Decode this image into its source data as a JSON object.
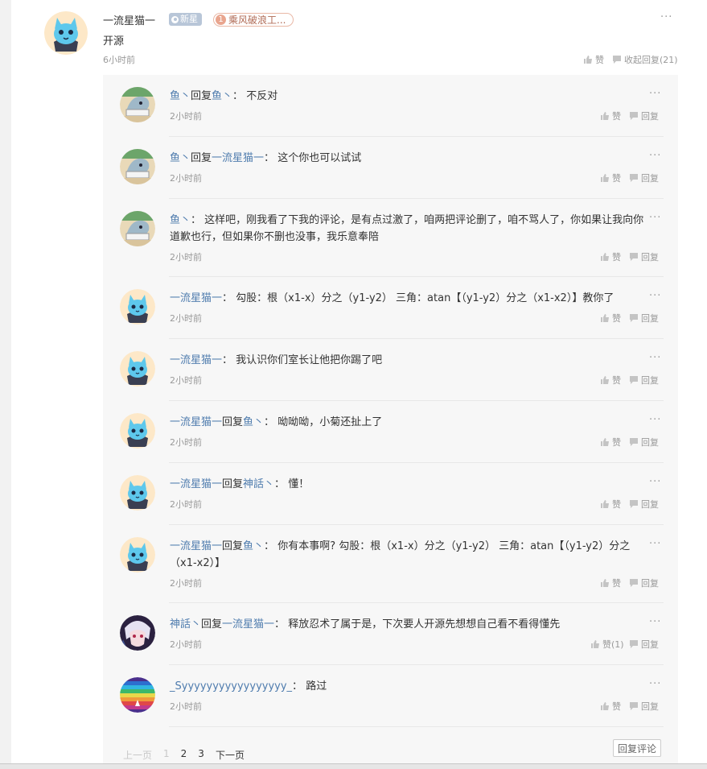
{
  "main_comment": {
    "username": "一流星猫一",
    "badge_new": "新星",
    "badge_level_num": "1",
    "badge_level_text": "乘风破浪工...",
    "content": "开源",
    "time": "6小时前",
    "like_label": "赞",
    "collapse_label": "收起回复(21)",
    "more": "···"
  },
  "replies": [
    {
      "avatar": "fish",
      "user": "鱼丶",
      "reply_word": "回复",
      "target": "鱼丶",
      "sep": "：",
      "text": "不反对",
      "time": "2小时前",
      "like": "赞",
      "reply": "回复"
    },
    {
      "avatar": "fish",
      "user": "鱼丶",
      "reply_word": "回复",
      "target": "一流星猫一",
      "sep": "：",
      "text": "这个你也可以试试",
      "time": "2小时前",
      "like": "赞",
      "reply": "回复"
    },
    {
      "avatar": "fish",
      "user": "鱼丶",
      "reply_word": "",
      "target": "",
      "sep": "：",
      "text": "这样吧，刚我看了下我的评论，是有点过激了，咱两把评论删了，咱不骂人了，你如果让我向你道歉也行，但如果你不删也没事，我乐意奉陪",
      "time": "2小时前",
      "like": "赞",
      "reply": "回复"
    },
    {
      "avatar": "cat",
      "user": "一流星猫一",
      "reply_word": "",
      "target": "",
      "sep": "：",
      "text": "勾股：根（x1-x）分之（y1-y2） 三角：atan【（y1-y2）分之（x1-x2）】教你了",
      "time": "2小时前",
      "like": "赞",
      "reply": "回复"
    },
    {
      "avatar": "cat",
      "user": "一流星猫一",
      "reply_word": "",
      "target": "",
      "sep": "：",
      "text": "我认识你们室长让他把你踢了吧",
      "time": "2小时前",
      "like": "赞",
      "reply": "回复"
    },
    {
      "avatar": "cat",
      "user": "一流星猫一",
      "reply_word": "回复",
      "target": "鱼丶",
      "sep": "：",
      "text": "呦呦呦，小菊还扯上了",
      "time": "2小时前",
      "like": "赞",
      "reply": "回复"
    },
    {
      "avatar": "cat",
      "user": "一流星猫一",
      "reply_word": "回复",
      "target": "神話丶",
      "sep": "：",
      "text": "懂！",
      "time": "2小时前",
      "like": "赞",
      "reply": "回复"
    },
    {
      "avatar": "cat",
      "user": "一流星猫一",
      "reply_word": "回复",
      "target": "鱼丶",
      "sep": "：",
      "text": "你有本事啊? 勾股：根（x1-x）分之（y1-y2） 三角：atan【（y1-y2）分之（x1-x2）】",
      "time": "2小时前",
      "like": "赞",
      "reply": "回复"
    },
    {
      "avatar": "anime",
      "user": "神話丶",
      "reply_word": "回复",
      "target": "一流星猫一",
      "sep": "：",
      "text": "释放忍术了属于是，下次要人开源先想想自己看不看得懂先",
      "time": "2小时前",
      "like": "赞(1)",
      "reply": "回复"
    },
    {
      "avatar": "rainbow",
      "user": "_Syyyyyyyyyyyyyyyyy_",
      "reply_word": "",
      "target": "",
      "sep": "：",
      "text": "路过",
      "time": "2小时前",
      "like": "赞",
      "reply": "回复"
    }
  ],
  "pager": {
    "prev": "上一页",
    "pages": [
      "1",
      "2",
      "3"
    ],
    "next": "下一页",
    "reply_comment": "回复评论"
  },
  "colors": {
    "username": "#4f7cae",
    "reply_bg": "#f7f7f7",
    "muted": "#999999"
  }
}
